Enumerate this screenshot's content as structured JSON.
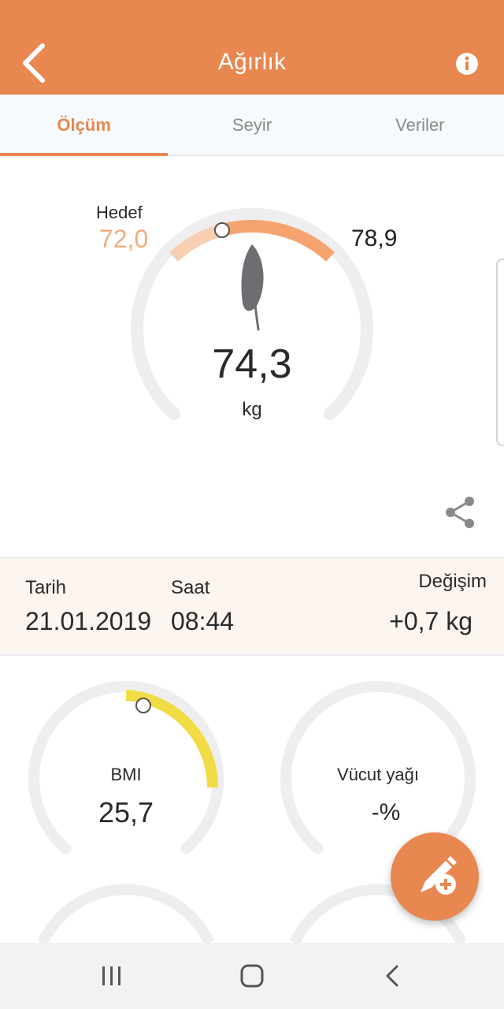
{
  "header": {
    "title": "Ağırlık",
    "back_icon": "chevron-left-icon",
    "info_icon": "info-icon",
    "color": "#e8874f"
  },
  "tabs": [
    {
      "label": "Ölçüm",
      "active": true
    },
    {
      "label": "Seyir",
      "active": false
    },
    {
      "label": "Veriler",
      "active": false
    }
  ],
  "gauge": {
    "target_label": "Hedef",
    "target_value": "72,0",
    "max_value": "78,9",
    "weight": "74,3",
    "unit": "kg",
    "icon": "feather-icon",
    "share_icon": "share-icon"
  },
  "measurement": {
    "date_label": "Tarih",
    "date_value": "21.01.2019",
    "time_label": "Saat",
    "time_value": "08:44",
    "change_label": "Değişim",
    "change_value": "+0,7 kg"
  },
  "small_gauges": [
    {
      "label": "BMI",
      "value": "25,7",
      "color": "#f2dc44"
    },
    {
      "label": "Vücut yağı",
      "value": "-%"
    }
  ],
  "fab": {
    "icon": "edit-add-icon"
  },
  "nav": {
    "icons": [
      "recent-apps-icon",
      "home-icon",
      "back-icon"
    ]
  }
}
